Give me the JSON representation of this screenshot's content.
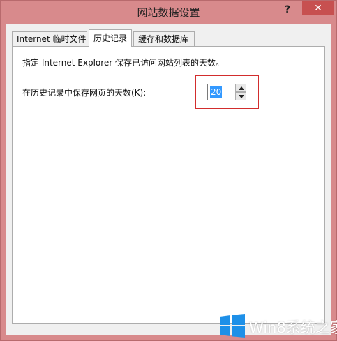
{
  "window": {
    "title": "网站数据设置",
    "help_label": "?",
    "close_label": "✕"
  },
  "tabs": [
    {
      "label": "Internet 临时文件",
      "active": false
    },
    {
      "label": "历史记录",
      "active": true
    },
    {
      "label": "缓存和数据库",
      "active": false
    }
  ],
  "history": {
    "description": "指定 Internet Explorer 保存已访问网站列表的天数。",
    "days_label": "在历史记录中保存网页的天数(K):",
    "days_value": "20"
  },
  "watermark": {
    "text": "Win8系统之家",
    "logo_icon": "windows-logo-icon"
  },
  "colors": {
    "frame": "#d88a8c",
    "close_button": "#c75050",
    "highlight_box": "#d22d2d",
    "selection": "#3399ff"
  }
}
